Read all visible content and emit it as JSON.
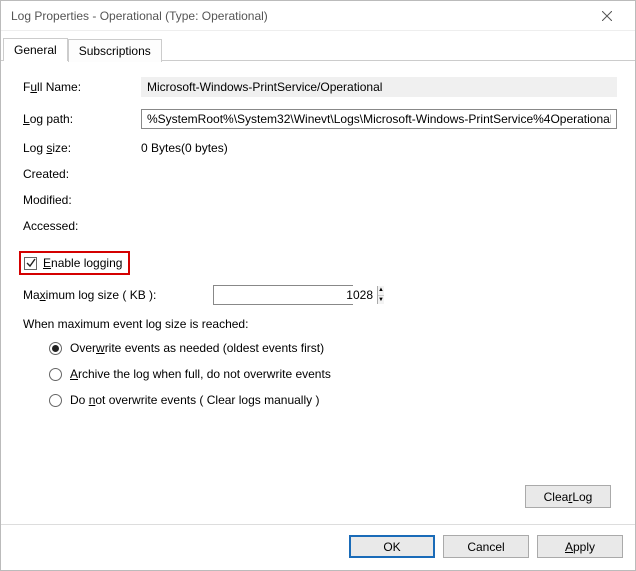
{
  "window": {
    "title": "Log Properties - Operational (Type: Operational)"
  },
  "tabs": {
    "general": "General",
    "subscriptions": "Subscriptions"
  },
  "labels": {
    "full_name_pre": "F",
    "full_name_u": "u",
    "full_name_post": "ll Name:",
    "log_path_u": "L",
    "log_path_post": "og path:",
    "log_size_pre": "Log ",
    "log_size_u": "s",
    "log_size_post": "ize:",
    "created": "Created:",
    "modified": "Modified:",
    "accessed": "Accessed:",
    "enable_pre": "",
    "enable_u": "E",
    "enable_post": "nable logging",
    "maxsize_pre": "Ma",
    "maxsize_u": "x",
    "maxsize_post": "imum log size ( KB ):",
    "when_max": "When maximum event log size is reached:",
    "r1_pre": "Over",
    "r1_u": "w",
    "r1_post": "rite events as needed (oldest events first)",
    "r2_pre": "",
    "r2_u": "A",
    "r2_post": "rchive the log when full, do not overwrite events",
    "r3_pre": "Do ",
    "r3_u": "n",
    "r3_post": "ot overwrite events ( Clear logs manually )"
  },
  "values": {
    "full_name": "Microsoft-Windows-PrintService/Operational",
    "log_path": "%SystemRoot%\\System32\\Winevt\\Logs\\Microsoft-Windows-PrintService%4Operational",
    "log_size": "0 Bytes(0 bytes)",
    "created": "",
    "modified": "",
    "accessed": "",
    "enable_checked": true,
    "max_size_kb": "1028",
    "radio_selected": 0
  },
  "buttons": {
    "clear_log_pre": "Clea",
    "clear_log_u": "r",
    "clear_log_post": " Log",
    "ok": "OK",
    "cancel": "Cancel",
    "apply_u": "A",
    "apply_post": "pply"
  }
}
